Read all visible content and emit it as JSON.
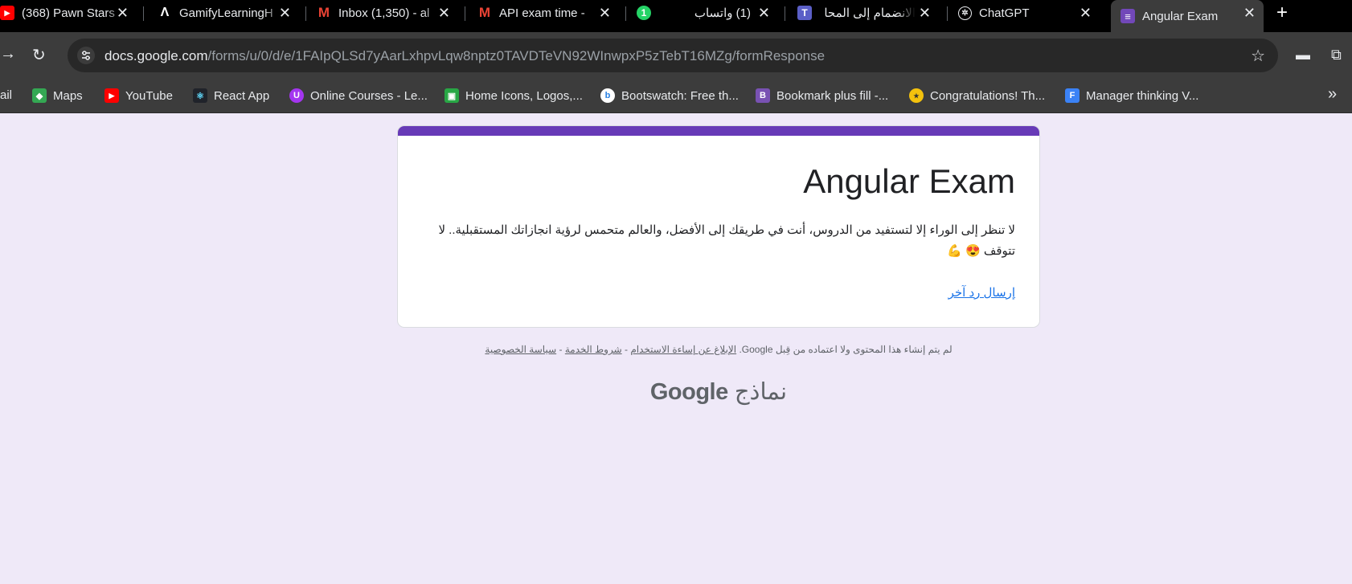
{
  "browser": {
    "tabs": [
      {
        "title": "(368) Pawn Stars",
        "icon": "youtube-icon"
      },
      {
        "title": "GamifyLearningH",
        "icon": "app-icon"
      },
      {
        "title": "Inbox (1,350) - al",
        "icon": "gmail-icon"
      },
      {
        "title": "API exam time -",
        "icon": "gmail-icon"
      },
      {
        "title": "(1) واتساب",
        "icon": "whatsapp-icon",
        "badge": "1"
      },
      {
        "title": "الانضمام إلى المحا",
        "icon": "teams-icon"
      },
      {
        "title": "ChatGPT",
        "icon": "chatgpt-icon"
      },
      {
        "title": "Angular Exam",
        "icon": "forms-icon",
        "active": true
      }
    ],
    "close_glyph": "✕",
    "new_tab_glyph": "+",
    "url_host": "docs.google.com",
    "url_path": "/forms/u/0/d/e/1FAIpQLSd7yAarLxhpvLqw8nptz0TAVDTeVN92WInwpxP5zTebT16MZg/formResponse",
    "bookmarks": [
      {
        "label": "ail"
      },
      {
        "label": "Maps"
      },
      {
        "label": "YouTube"
      },
      {
        "label": "React App"
      },
      {
        "label": "Online Courses - Le..."
      },
      {
        "label": "Home Icons, Logos,..."
      },
      {
        "label": "Bootswatch: Free th..."
      },
      {
        "label": "Bookmark plus fill -..."
      },
      {
        "label": "Congratulations! Th..."
      },
      {
        "label": "Manager thinking V..."
      }
    ]
  },
  "form": {
    "title": "Angular Exam",
    "message": "لا تنظر إلى الوراء إلا لتستفيد من الدروس، أنت في طريقك إلى الأفضل، والعالم متحمس لرؤية انجازاتك المستقبلية.. لا تتوقف 😍 💪",
    "submit_another": "إرسال رد آخر"
  },
  "footer": {
    "disclaimer_prefix": "لم يتم إنشاء هذا المحتوى ولا اعتماده من قِبل Google.",
    "report_abuse": "الإبلاغ عن إساءة الاستخدام",
    "terms": "شروط الخدمة",
    "privacy": "سياسة الخصوصية",
    "separator": "-",
    "logo_google": "Google",
    "logo_forms": "نماذج"
  },
  "colors": {
    "accent": "#673ab7",
    "background": "#efe9f8",
    "link": "#1a73e8"
  }
}
